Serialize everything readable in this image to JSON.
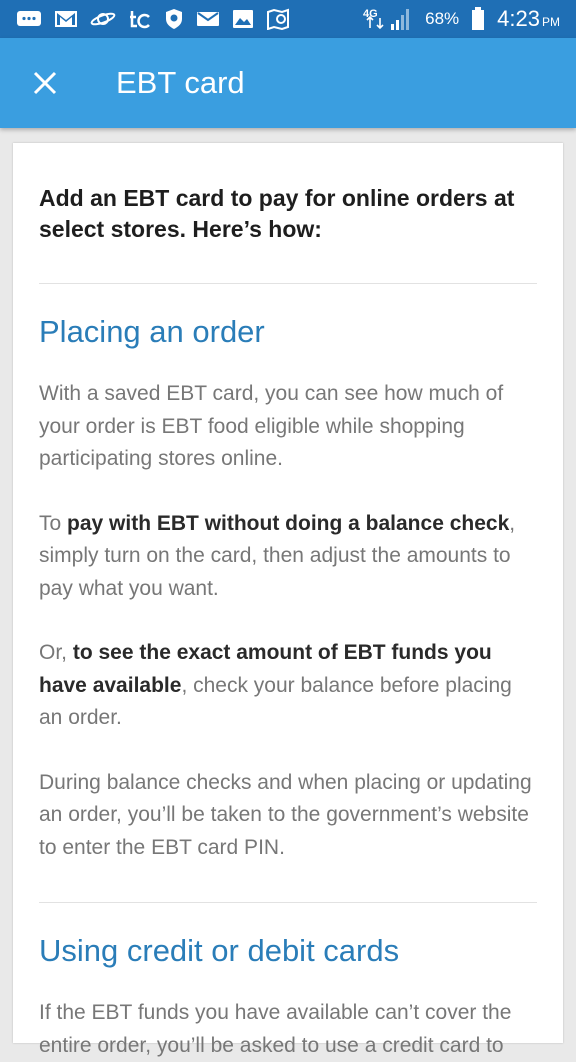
{
  "status_bar": {
    "battery": "68%",
    "time": "4:23",
    "ampm": "PM",
    "network": "4G",
    "left_icons": [
      "message-icon",
      "gmail-icon",
      "saturn-icon",
      "tc-icon",
      "shield-icon",
      "email-icon",
      "gallery-icon",
      "maps-icon"
    ]
  },
  "app_bar": {
    "title": "EBT card",
    "close_icon": "close-icon"
  },
  "content": {
    "intro": "Add an EBT card to pay for online orders at select stores. Here’s how:",
    "placing": {
      "title": "Placing an order",
      "p1": "With a saved EBT card, you can see how much of your order is EBT food eligible while shopping participating stores online.",
      "p2_prefix": "To ",
      "p2_bold": "pay with EBT without doing a balance check",
      "p2_suffix": ", simply turn on the card, then adjust the amounts to pay what you want.",
      "p3_prefix": "Or, ",
      "p3_bold": "to see the exact amount of EBT funds you have available",
      "p3_suffix": ", check your balance before placing an order.",
      "p4": "During balance checks and when placing or updating an order, you’ll be taken to the government’s website to enter the EBT card PIN."
    },
    "using_cards": {
      "title": "Using credit or debit cards",
      "p1": "If the EBT funds you have available can’t cover the entire order, you’ll be asked to use a credit card to"
    }
  }
}
